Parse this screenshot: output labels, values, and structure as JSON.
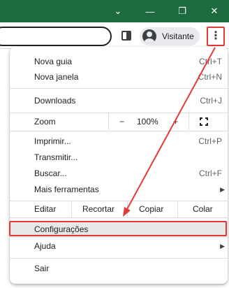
{
  "titlebar": {
    "minimize_glyph": "⌄",
    "minimize_btn": "—",
    "restore_btn": "❐",
    "close_btn": "✕"
  },
  "toolbar": {
    "profile_label": "Visitante",
    "menu_glyph": "⋮"
  },
  "menu": {
    "new_tab": {
      "label": "Nova guia",
      "shortcut": "Ctrl+T"
    },
    "new_window": {
      "label": "Nova janela",
      "shortcut": "Ctrl+N"
    },
    "downloads": {
      "label": "Downloads",
      "shortcut": "Ctrl+J"
    },
    "zoom": {
      "label": "Zoom",
      "minus": "−",
      "value": "100%",
      "plus": "+"
    },
    "print": {
      "label": "Imprimir...",
      "shortcut": "Ctrl+P"
    },
    "cast": {
      "label": "Transmitir..."
    },
    "find": {
      "label": "Buscar...",
      "shortcut": "Ctrl+F"
    },
    "more_tools": {
      "label": "Mais ferramentas",
      "arrow": "▶"
    },
    "edit": {
      "label": "Editar",
      "cut": "Recortar",
      "copy": "Copiar",
      "paste": "Colar"
    },
    "settings": {
      "label": "Configurações"
    },
    "help": {
      "label": "Ajuda",
      "arrow": "▶"
    },
    "exit": {
      "label": "Sair"
    }
  },
  "colors": {
    "titlebar": "#1d6b3f",
    "annotation": "#e53935",
    "hover": "#e8e8e8"
  }
}
